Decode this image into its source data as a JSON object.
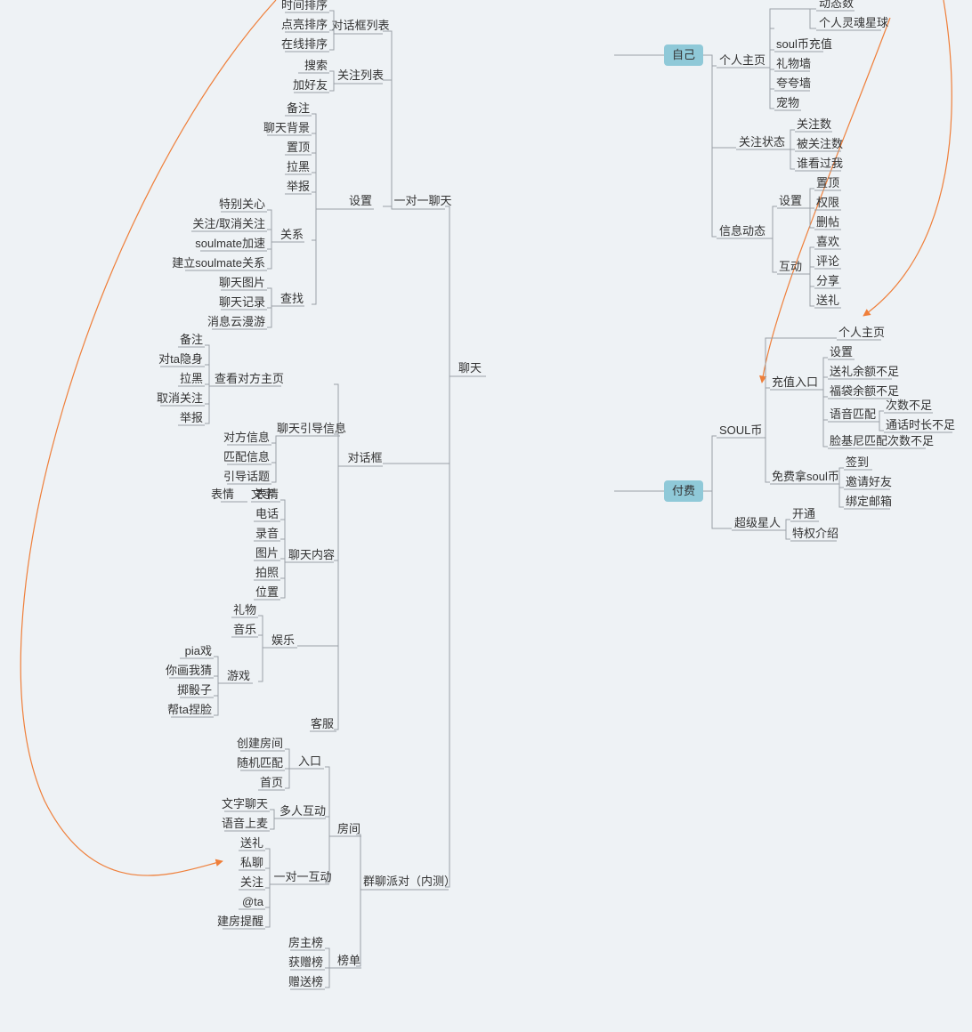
{
  "left": {
    "root": "聊天",
    "one_to_one": {
      "label": "一对一聊天",
      "dialog_list": {
        "label": "对话框列表",
        "items": [
          "时间排序",
          "点亮排序",
          "在线排序"
        ]
      },
      "follow_list": {
        "label": "关注列表",
        "items": [
          "搜索",
          "加好友"
        ]
      },
      "settings": {
        "label": "设置",
        "items": [
          "备注",
          "聊天背景",
          "置顶",
          "拉黑",
          "举报"
        ],
        "relation": {
          "label": "关系",
          "items": [
            "特别关心",
            "关注/取消关注",
            "soulmate加速",
            "建立soulmate关系"
          ]
        },
        "search": {
          "label": "查找",
          "items": [
            "聊天图片",
            "聊天记录",
            "消息云漫游"
          ]
        }
      }
    },
    "dialog": {
      "label": "对话框",
      "view_profile": {
        "label": "查看对方主页",
        "items": [
          "备注",
          "对ta隐身",
          "拉黑",
          "取消关注",
          "举报"
        ]
      },
      "guide": {
        "label": "聊天引导信息",
        "items": [
          "对方信息",
          "匹配信息",
          "引导话题"
        ]
      },
      "content": {
        "label": "聊天内容",
        "items": [
          "表情",
          "文字",
          "电话",
          "录音",
          "图片",
          "拍照",
          "位置"
        ]
      },
      "entertain": {
        "label": "娱乐",
        "items": [
          "礼物",
          "音乐"
        ],
        "game": {
          "label": "游戏",
          "items": [
            "pia戏",
            "你画我猜",
            "掷骰子",
            "帮ta捏脸"
          ]
        }
      },
      "kefu": "客服"
    },
    "group": {
      "label": "群聊派对（内测）",
      "room": {
        "label": "房间",
        "entry": {
          "label": "入口",
          "items": [
            "创建房间",
            "随机匹配",
            "首页"
          ]
        },
        "multi": {
          "label": "多人互动",
          "items": [
            "文字聊天",
            "语音上麦"
          ]
        },
        "single": {
          "label": "一对一互动",
          "items": [
            "送礼",
            "私聊",
            "关注",
            "@ta",
            "建房提醒"
          ]
        }
      },
      "rank": {
        "label": "榜单",
        "items": [
          "房主榜",
          "获赠榜",
          "赠送榜"
        ]
      }
    }
  },
  "right": {
    "self": {
      "label": "自己",
      "profile": {
        "label": "个人主页",
        "sub": [
          "动态数",
          "个人灵魂星球"
        ],
        "items": [
          "soul币充值",
          "礼物墙",
          "夸夸墙",
          "宠物"
        ]
      },
      "follow": {
        "label": "关注状态",
        "items": [
          "关注数",
          "被关注数",
          "谁看过我"
        ]
      },
      "feed": {
        "label": "信息动态",
        "set": {
          "label": "设置",
          "items": [
            "置顶",
            "权限",
            "删帖"
          ]
        },
        "act": {
          "label": "互动",
          "items": [
            "喜欢",
            "评论",
            "分享",
            "送礼"
          ]
        }
      }
    },
    "pay": {
      "label": "付费",
      "soul": {
        "label": "SOUL币",
        "profile": "个人主页",
        "recharge": {
          "label": "充值入口",
          "items": [
            "设置",
            "送礼余额不足",
            "福袋余额不足"
          ],
          "voice": {
            "label": "语音匹配",
            "items": [
              "次数不足",
              "通话时长不足"
            ]
          },
          "face": "脸基尼匹配次数不足"
        },
        "free": {
          "label": "免费拿soul币",
          "items": [
            "签到",
            "邀请好友",
            "绑定邮箱"
          ]
        }
      },
      "super": {
        "label": "超级星人",
        "items": [
          "开通",
          "特权介绍"
        ]
      }
    }
  }
}
